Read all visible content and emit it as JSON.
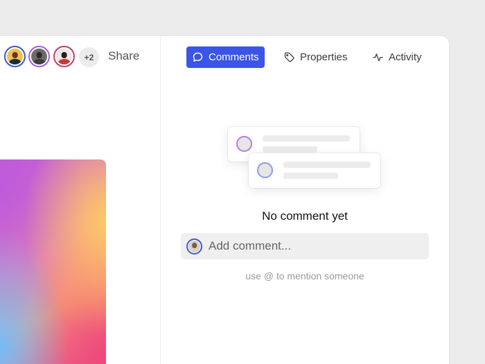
{
  "toolbar": {
    "avatars": [
      {
        "name": "collaborator-1",
        "ring_color": "#3b57d6"
      },
      {
        "name": "collaborator-2",
        "ring_color": "#a75cd9"
      },
      {
        "name": "collaborator-3",
        "ring_color": "#c23b72"
      }
    ],
    "more_count": "+2",
    "share_label": "Share"
  },
  "tabs": [
    {
      "label": "Comments",
      "icon": "comment-bubble-icon",
      "active": true
    },
    {
      "label": "Properties",
      "icon": "tag-icon",
      "active": false
    },
    {
      "label": "Activity",
      "icon": "activity-pulse-icon",
      "active": false
    }
  ],
  "comments": {
    "empty_title": "No comment yet",
    "input_placeholder": "Add comment...",
    "hint": "use @ to mention someone"
  },
  "colors": {
    "accent": "#3a55e7",
    "background": "#ebebeb",
    "panel": "#ffffff"
  }
}
